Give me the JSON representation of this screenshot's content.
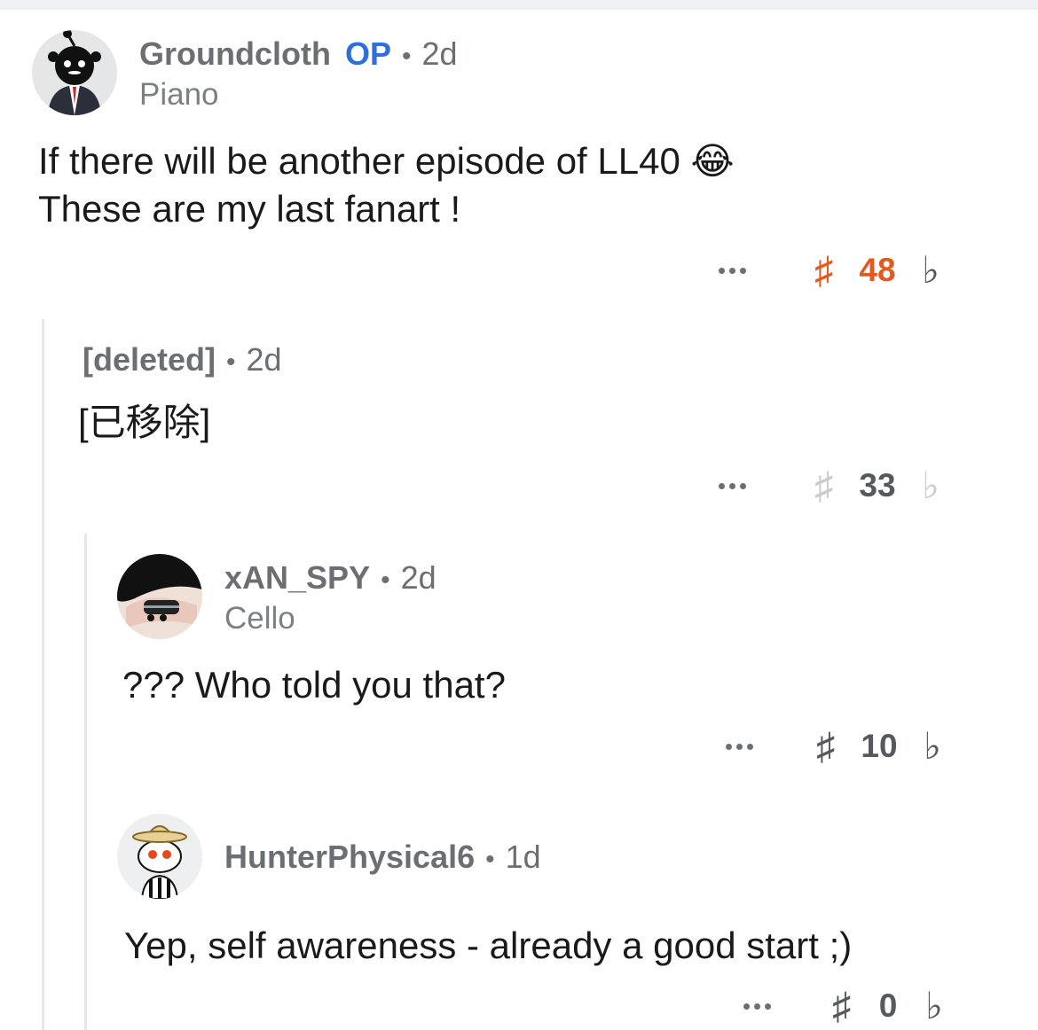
{
  "comments": [
    {
      "username": "Groundcloth",
      "op_badge": "OP",
      "age": "2d",
      "flair": "Piano",
      "body_lines": [
        "If there will be another episode of LL40 😂",
        "These are my last fanart !"
      ],
      "score": "48",
      "voted": "up"
    },
    {
      "username": "[deleted]",
      "age": "2d",
      "body": "[已移除]",
      "score": "33"
    },
    {
      "username": "xAN_SPY",
      "age": "2d",
      "flair": "Cello",
      "body": "??? Who told you that?",
      "score": "10"
    },
    {
      "username": "HunterPhysical6",
      "age": "1d",
      "body": "Yep, self awareness - already a good start ;)",
      "score": "0"
    }
  ],
  "icons": {
    "more": "more-options-icon",
    "upvote": "upvote-icon",
    "downvote": "downvote-icon"
  },
  "colors": {
    "upvoted": "#e25a1f",
    "op_badge": "#2e6fd8",
    "meta_text": "#6b6f73"
  }
}
